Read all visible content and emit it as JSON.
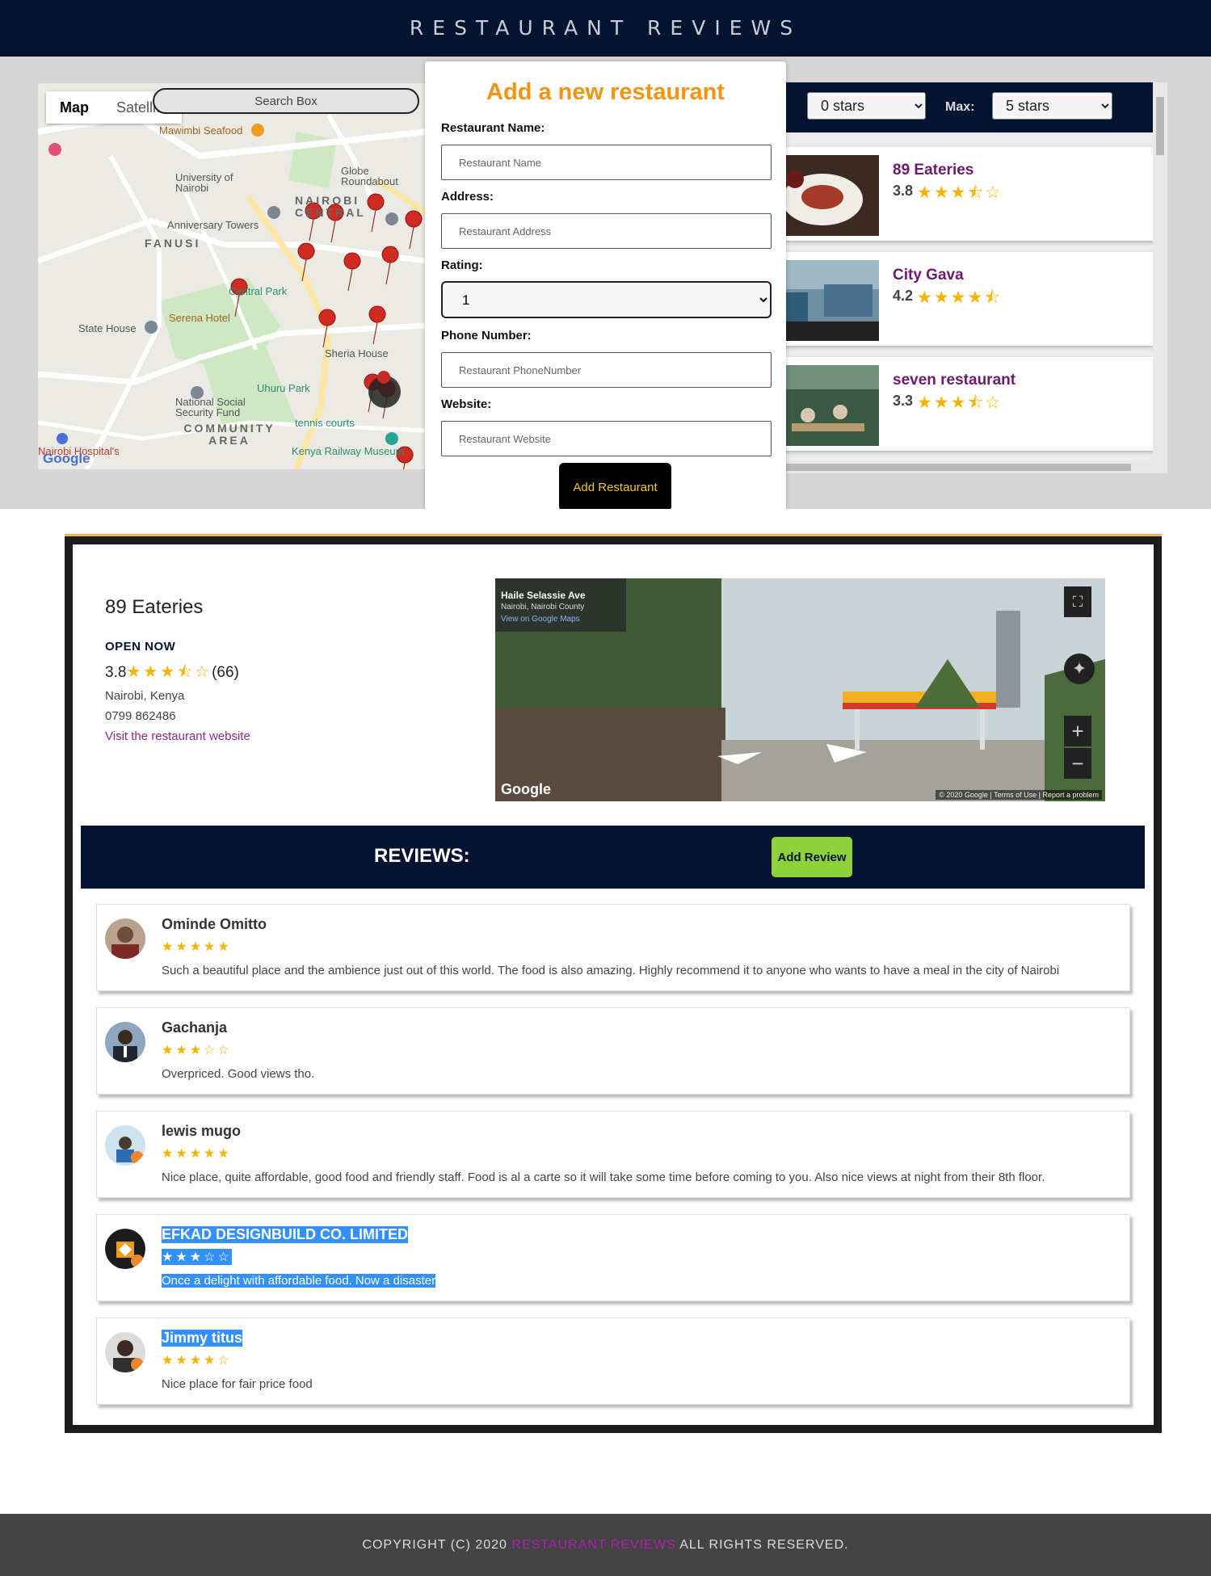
{
  "header": {
    "title": "RESTAURANT REVIEWS"
  },
  "map": {
    "type_buttons": [
      "Map",
      "Satellite"
    ],
    "search_placeholder": "Search Box",
    "labels": {
      "mawimbi": "Mawimbi Seafood",
      "university": "University of Nairobi",
      "globe": "Globe Roundabout",
      "nairobi_central": "NAIROBI CENTRAL",
      "fanusi": "FANUSI",
      "anniversary": "Anniversary Towers",
      "central_park": "Central Park",
      "serena": "Serena Hotel",
      "state_house": "State House",
      "sheria": "Sheria House",
      "uhuru": "Uhuru Park",
      "nssf": "National Social Security Fund",
      "community": "COMMUNITY AREA",
      "tennis": "tennis courts",
      "railway": "Kenya Railway Museum",
      "hospital": "Nairobi Hospital's",
      "google": "Google"
    }
  },
  "filters": {
    "min_value": "0 stars",
    "max_label": "Max:",
    "max_value": "5 stars"
  },
  "restaurant_list": [
    {
      "name": "89 Eateries",
      "rating": "3.8",
      "stars": "★★★⯪☆"
    },
    {
      "name": "City Gava",
      "rating": "4.2",
      "stars": "★★★★⯪"
    },
    {
      "name": "seven restaurant",
      "rating": "3.3",
      "stars": "★★★⯪☆"
    }
  ],
  "modal": {
    "title": "Add a new restaurant",
    "name_label": "Restaurant Name:",
    "name_placeholder": "Restaurant Name",
    "address_label": "Address:",
    "address_placeholder": "Restaurant Address",
    "rating_label": "Rating:",
    "rating_value": "1",
    "phone_label": "Phone Number:",
    "phone_placeholder": "Restaurant PhoneNumber",
    "website_label": "Website:",
    "website_placeholder": "Restaurant Website",
    "submit_label": "Add Restaurant"
  },
  "detail": {
    "name": "89 Eateries",
    "status": "OPEN NOW",
    "rating": "3.8",
    "stars": "★★★⯪☆",
    "count": "(66)",
    "address": "Nairobi, Kenya",
    "phone": "0799 862486",
    "website_link": "Visit the restaurant website",
    "streetview": {
      "street": "Haile Selassie Ave",
      "area": "Nairobi, Nairobi County",
      "link": "View on Google Maps",
      "google": "Google",
      "footer": "© 2020 Google | Terms of Use | Report a problem"
    }
  },
  "reviews_bar": {
    "label": "REVIEWS:",
    "add_label": "Add Review"
  },
  "reviews": [
    {
      "author": "Ominde Omitto",
      "stars": "★★★★★",
      "text": "Such a beautiful place and the ambience just out of this world. The food is also amazing. Highly recommend it to anyone who wants to have a meal in the city of Nairobi"
    },
    {
      "author": "Gachanja",
      "stars": "★★★☆☆",
      "text": "Overpriced. Good views tho."
    },
    {
      "author": "lewis mugo",
      "stars": "★★★★★",
      "text": "Nice place, quite affordable, good food and friendly staff. Food is al a carte so it will take some time before coming to you. Also nice views at night from their 8th floor."
    },
    {
      "author": "EFKAD DESIGNBUILD CO. LIMITED",
      "stars": "★★★☆☆",
      "text": "Once a delight with affordable food. Now a disaster"
    },
    {
      "author": "Jimmy titus",
      "stars": "★★★★☆",
      "text": "Nice place for fair price food"
    }
  ],
  "footer": {
    "prefix": "COPYRIGHT (C) 2020",
    "brand": "RESTAURANT REVIEWS",
    "suffix": "ALL RIGHTS RESERVED."
  },
  "colors": {
    "navy": "#041430",
    "accent_orange": "#f29312",
    "star_gold": "#f5b400",
    "add_review_green": "#8ed13b",
    "brand_magenta": "#b21fb2",
    "selection_blue": "#3390ff"
  }
}
